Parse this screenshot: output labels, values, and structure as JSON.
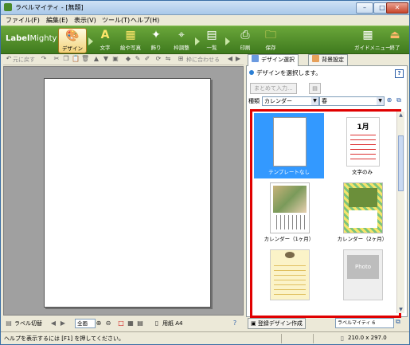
{
  "window": {
    "title": "ラベルマイティ - [無題]",
    "btn_min": "–",
    "btn_max": "□",
    "btn_close": "✕"
  },
  "menu": [
    "ファイル(F)",
    "編集(E)",
    "表示(V)",
    "ツール(T)",
    "ヘルプ(H)"
  ],
  "ribbon": {
    "logo_bold": "Label",
    "logo_light": "Mighty",
    "buttons": [
      {
        "label": "デザイン",
        "icon": "🎨"
      },
      {
        "label": "文字",
        "icon": "A"
      },
      {
        "label": "絵や写真",
        "icon": "▦"
      },
      {
        "label": "飾り",
        "icon": "✦"
      },
      {
        "label": "枠調整",
        "icon": "⌖"
      },
      {
        "label": "一覧",
        "icon": "▤"
      },
      {
        "label": "印刷",
        "icon": "⎙"
      },
      {
        "label": "保存",
        "icon": "🗀"
      },
      {
        "label": "ガイドメニュー",
        "icon": "▦"
      },
      {
        "label": "終了",
        "icon": "⏏"
      }
    ]
  },
  "toolbar1": {
    "undo": "元に戻す",
    "align": "枠に合わせる"
  },
  "tabs": {
    "design": "デザイン選択",
    "background": "背景設定"
  },
  "design_pane": {
    "prompt": "デザインを選択します。",
    "help": "?",
    "batch_input": "まとめて入力...",
    "filter_label": "種類",
    "category": "カレンダー",
    "subcategory": "春",
    "tiles": [
      {
        "label": "テンプレートなし"
      },
      {
        "label": "文字のみ",
        "month": "1月"
      },
      {
        "label": "カレンダー（1ヶ月）"
      },
      {
        "label": "カレンダー（2ヶ月）"
      },
      {
        "label": ""
      },
      {
        "label": "",
        "photo": "Photo"
      }
    ]
  },
  "bottom_right": {
    "register": "登録デザイン作成",
    "combo": "ラベルマイティ 6"
  },
  "bottom_left": {
    "label_switch": "ラベル切替",
    "zoom": "全画",
    "size_label": "用紙 A4"
  },
  "status": {
    "hint": "ヘルプを表示するには [F1] を押してください。",
    "size": "210.0 x 297.0"
  }
}
